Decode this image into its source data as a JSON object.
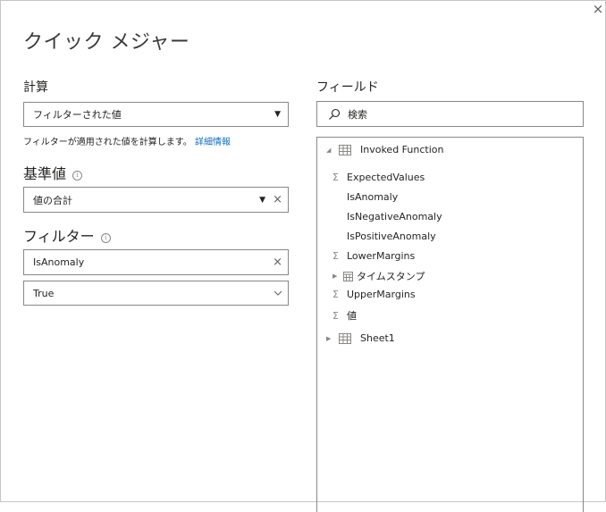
{
  "dialog": {
    "title": "クイック メジャー",
    "close_label": "×"
  },
  "calculation": {
    "label": "計算",
    "selected": "フィルターされた値",
    "description": "フィルターが適用された値を計算します。",
    "learn_more": "詳細情報"
  },
  "base_value": {
    "label": "基準値",
    "value": "値の合計"
  },
  "filter": {
    "label": "フィルター",
    "field": "IsAnomaly",
    "value": "True"
  },
  "fields": {
    "label": "フィールド",
    "search_placeholder": "検索",
    "tables": [
      {
        "name": "Invoked Function",
        "expanded": true,
        "items": [
          {
            "name": "ExpectedValues",
            "icon": "sigma-icon"
          },
          {
            "name": "IsAnomaly",
            "icon": ""
          },
          {
            "name": "IsNegativeAnomaly",
            "icon": ""
          },
          {
            "name": "IsPositiveAnomaly",
            "icon": ""
          },
          {
            "name": "LowerMargins",
            "icon": "sigma-icon"
          },
          {
            "name": "タイムスタンプ",
            "icon": "calendar-icon"
          },
          {
            "name": "UpperMargins",
            "icon": "sigma-icon"
          },
          {
            "name": "値",
            "icon": "sigma-icon"
          }
        ]
      },
      {
        "name": "Sheet1",
        "expanded": false
      }
    ]
  }
}
